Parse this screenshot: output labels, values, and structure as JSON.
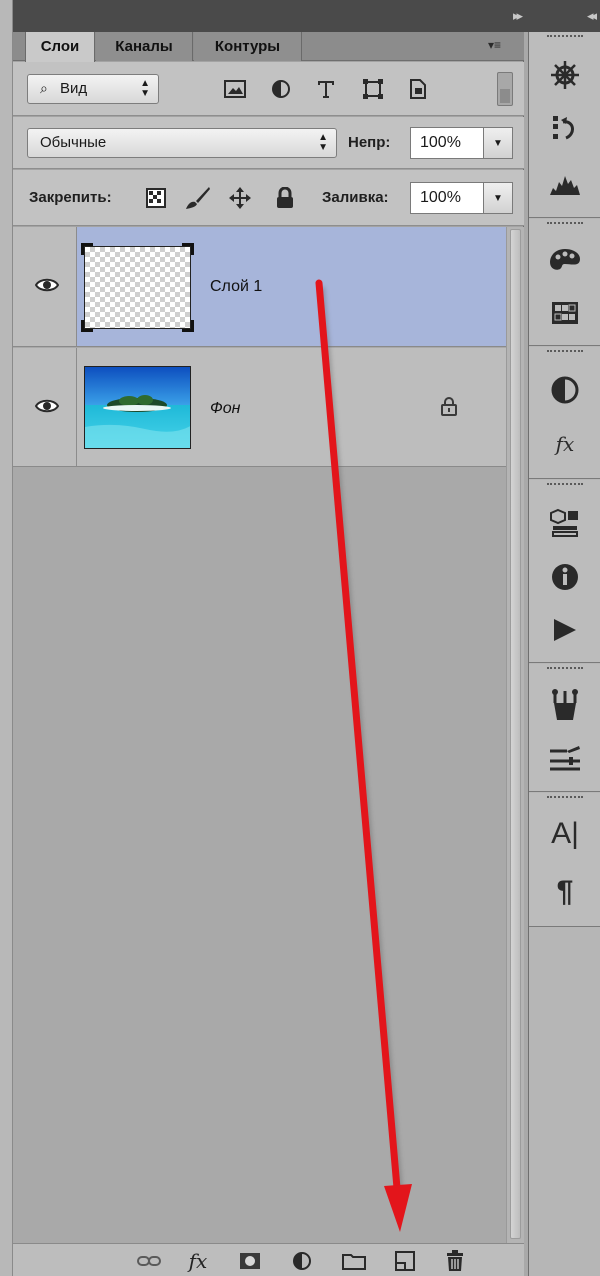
{
  "window": {
    "collapse_left": "▸▸",
    "collapse_right": "◂◂"
  },
  "tabs": [
    {
      "label": "Слои",
      "active": true
    },
    {
      "label": "Каналы",
      "active": false
    },
    {
      "label": "Контуры",
      "active": false
    }
  ],
  "panel_menu_icon": "▾≡",
  "filter": {
    "kind_label": "Вид",
    "search_glyph": "⌕"
  },
  "blend": {
    "mode": "Обычные",
    "opacity_label": "Непр:",
    "opacity_value": "100%"
  },
  "lock": {
    "label": "Закрепить:",
    "fill_label": "Заливка:",
    "fill_value": "100%"
  },
  "layers": [
    {
      "name": "Слой 1",
      "selected": true,
      "locked": false,
      "thumbnail": "transparent"
    },
    {
      "name": "Фон",
      "selected": false,
      "locked": true,
      "thumbnail": "island-photo"
    }
  ],
  "bottom_icons": [
    "link-icon",
    "fx-icon",
    "mask-icon",
    "adjustment-icon",
    "folder-icon",
    "new-layer-icon",
    "trash-icon"
  ],
  "bottom_fx": "fx",
  "dock": {
    "type_letter": "A|",
    "paragraph": "¶",
    "fx": "fx"
  },
  "annotation": {
    "color": "#e3151b",
    "points_to": "new-layer-icon"
  },
  "colors": {
    "selected_layer": "#a7b5da",
    "panel_bg": "#a3a3a3",
    "arrow": "#e3151b"
  }
}
